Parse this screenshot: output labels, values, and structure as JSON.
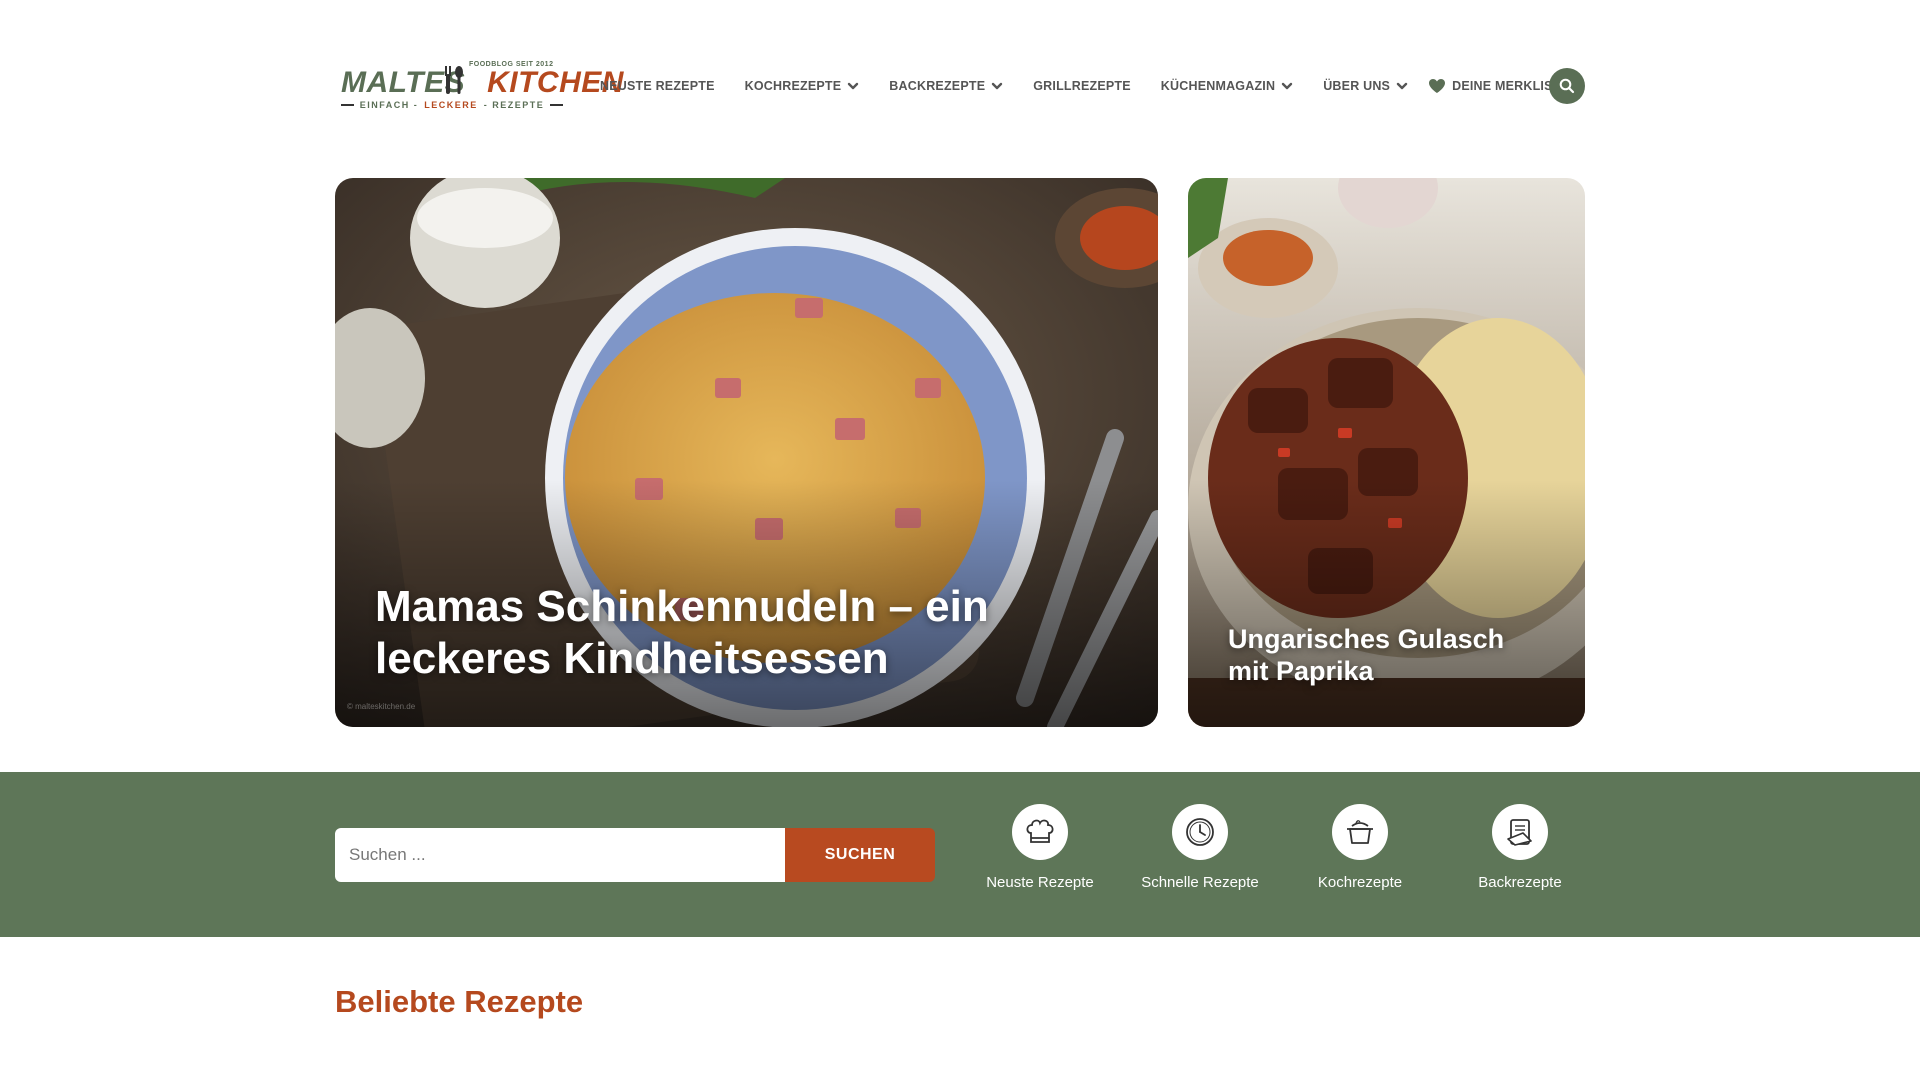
{
  "logo": {
    "word1": "MALTES",
    "word2": "KITCHEN",
    "tagline_top": "FOODBLOG SEIT 2012",
    "tagline_a": "EINFACH -",
    "tagline_b": "LECKERE",
    "tagline_c": "- REZEPTE"
  },
  "nav": {
    "items": [
      {
        "label": "NEUSTE REZEPTE",
        "dropdown": false
      },
      {
        "label": "KOCHREZEPTE",
        "dropdown": true
      },
      {
        "label": "BACKREZEPTE",
        "dropdown": true
      },
      {
        "label": "GRILLREZEPTE",
        "dropdown": false
      },
      {
        "label": "KÜCHENMAGAZIN",
        "dropdown": true
      },
      {
        "label": "ÜBER UNS",
        "dropdown": true
      }
    ],
    "wishlist_label": "DEINE MERKLISTE"
  },
  "hero": {
    "main_title": "Mamas Schinkennudeln – ein leckeres Kindheitsessen",
    "side_title": "Ungarisches Gulasch mit Paprika",
    "watermark": "© malteskitchen.de"
  },
  "search": {
    "placeholder": "Suchen ...",
    "button_label": "SUCHEN"
  },
  "categories": [
    {
      "label": "Neuste Rezepte",
      "icon": "chef-hat-icon"
    },
    {
      "label": "Schnelle Rezepte",
      "icon": "clock-icon"
    },
    {
      "label": "Kochrezepte",
      "icon": "cooking-pot-icon"
    },
    {
      "label": "Backrezepte",
      "icon": "recipe-book-icon"
    }
  ],
  "popular": {
    "title": "Beliebte Rezepte"
  },
  "colors": {
    "brand_green": "#5e7658",
    "brand_orange": "#b84a20"
  }
}
